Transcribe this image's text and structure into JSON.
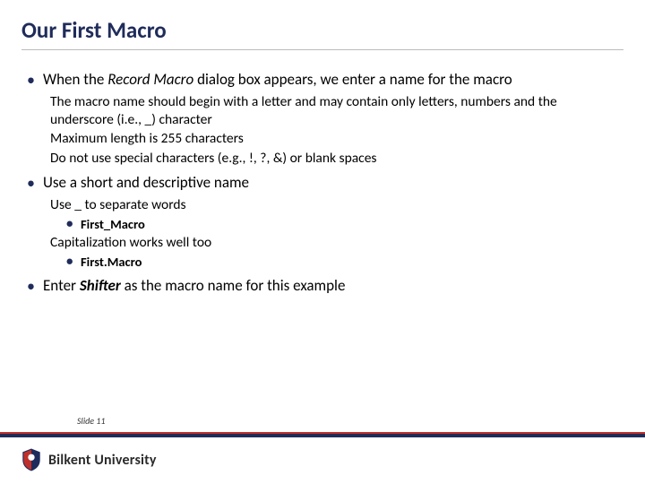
{
  "title": "Our First Macro",
  "bullets": {
    "b1_pre": "When the ",
    "b1_em": "Record Macro",
    "b1_post": " dialog box appears, we enter a name for the macro",
    "b1_sub1": "The macro name should begin with a letter and may contain only letters, numbers and the underscore (i.e., _) character",
    "b1_sub2": "Maximum length is 255 characters",
    "b1_sub3": "Do not use special characters (e.g., !, ?, &) or blank spaces",
    "b2": "Use a short and descriptive name",
    "b2_sub1": "Use _ to separate words",
    "b2_sub1_ex": "First_Macro",
    "b2_sub2": "Capitalization works well too",
    "b2_sub2_ex": "First.Macro",
    "b3_pre": "Enter ",
    "b3_em": "Shifter",
    "b3_post": " as the macro name for this example"
  },
  "footer": {
    "slide_label": "Slide 11",
    "university": "Bilkent University"
  },
  "colors": {
    "heading": "#1f2c5b",
    "bar_red": "#c0302b",
    "bar_blue": "#1f2c5b"
  }
}
